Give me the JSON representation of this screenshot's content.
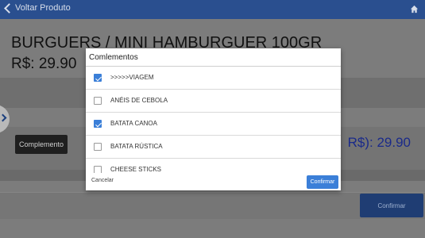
{
  "header": {
    "back_label": "Voltar Produto",
    "home_icon": "home-icon"
  },
  "product": {
    "title": "BURGUERS / MINI HAMBURGUER 100GR",
    "price": "R$: 29.90",
    "total": "R$): 29.90"
  },
  "buttons": {
    "complemento": "Complemento",
    "confirmar": "Confirmar"
  },
  "dialog": {
    "title": "Comlementos",
    "cancel_label": "Cancelar",
    "confirm_label": "Confirmar",
    "options": [
      {
        "label": ">>>>>VIAGEM",
        "checked": true
      },
      {
        "label": "ANÉIS DE CEBOLA",
        "checked": false
      },
      {
        "label": "BATATA CANOA",
        "checked": true
      },
      {
        "label": "BATATA RÚSTICA",
        "checked": false
      },
      {
        "label": "CHEESE STICKS",
        "checked": false
      }
    ]
  },
  "colors": {
    "header_bg": "#2a4f8f",
    "accent": "#3b7fd8",
    "total_text": "#1a2a8a"
  }
}
